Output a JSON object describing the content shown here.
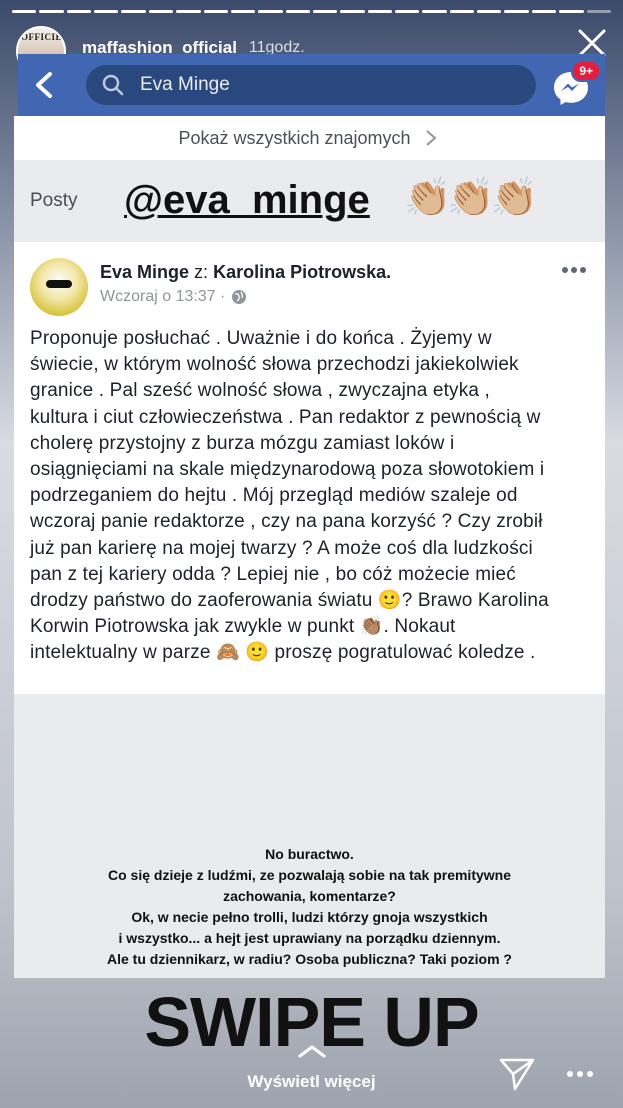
{
  "story": {
    "progress_segments": 22,
    "progress_done": 21,
    "avatar_text": "OFFICIEL",
    "username": "maffashion_official",
    "time": "11godz.",
    "see_more": "Wyświetl więcej",
    "swipe_up": "SWIPE UP",
    "caption": [
      "No buractwo.",
      "Co się dzieje z ludźmi, ze pozwalają sobie na tak premitywne",
      "zachowania, komentarze?",
      "Ok, w necie pełno trolli, ludzi którzy gnoja wszystkich",
      "i wszystko... a hejt jest uprawiany na porządku dziennym.",
      "Ale tu dziennikarz, w radiu? Osoba publiczna? Taki poziom ?"
    ],
    "mention": "@eva_minge",
    "mention_emoji": "👏🏼👏🏼👏🏼"
  },
  "fb": {
    "search_value": "Eva Minge",
    "badge": "9+",
    "show_all": "Pokaż wszystkich znajomych",
    "posts_label": "Posty",
    "post": {
      "author": "Eva Minge",
      "with_prefix": "z:",
      "with": "Karolina Piotrowska.",
      "time": "Wczoraj o 13:37 ·",
      "lines": [
        "Proponuje posłuchać . Uważnie i do końca . Żyjemy w",
        "świecie, w którym wolność słowa przechodzi jakiekolwiek",
        "granice . Pal sześć wolność słowa , zwyczajna etyka ,",
        "kultura i ciut człowieczeństwa . Pan redaktor z pewnością w",
        "cholerę przystojny z burza mózgu zamiast loków i",
        "osiągnięciami na skale międzynarodową poza słowotokiem i",
        "podrzeganiem do hejtu . Mój przegląd mediów szaleje od",
        "wczoraj panie redaktorze , czy na pana korzyść ? Czy zrobił",
        "już pan karierę na mojej twarzy ? A może coś dla ludzkości",
        "pan z tej kariery odda ? Lepiej nie , bo cóż możecie mieć",
        "drodzy państwo do zaoferowania światu 🙂? Brawo Karolina",
        "Korwin Piotrowska jak zwykle w punkt 👏🏽. Nokaut",
        "intelektualny w parze 🙈 🙂 proszę pogratulować koledze ."
      ]
    }
  },
  "colors": {
    "fb_blue": "#4267b2",
    "fb_search_bg": "#29487d",
    "badge_red": "#e41e3f"
  },
  "icons": [
    "close-icon",
    "back-chevron-icon",
    "search-icon",
    "messenger-icon",
    "chevron-right-icon",
    "globe-icon",
    "more-dots-icon",
    "swipe-up-chevron-icon",
    "send-icon"
  ]
}
